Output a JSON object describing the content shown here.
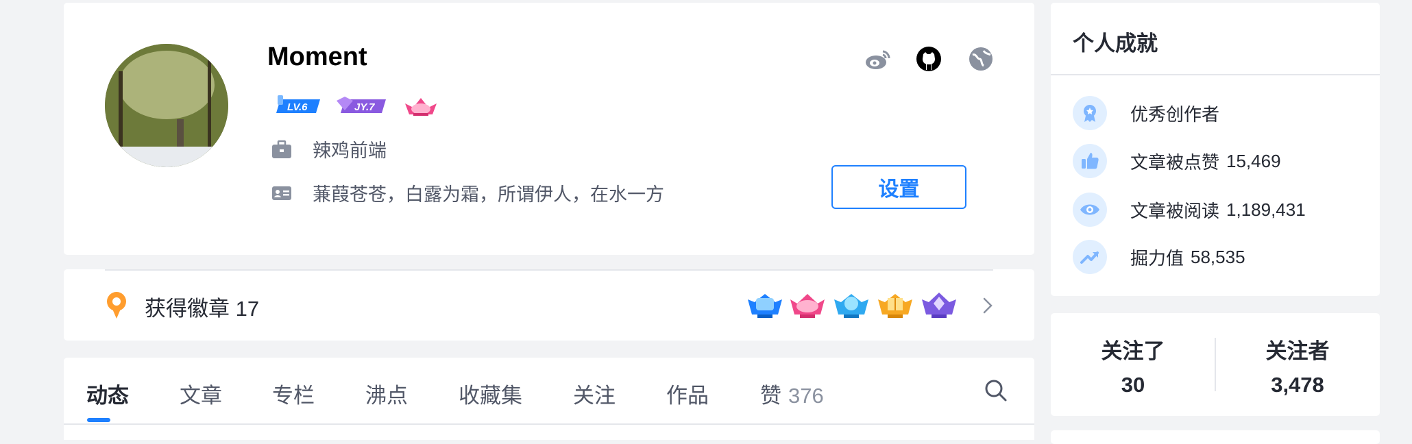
{
  "profile": {
    "username": "Moment",
    "levels": [
      {
        "name": "level-badge",
        "text": "LV.6",
        "color": "#1e80ff"
      },
      {
        "name": "jy-badge",
        "text": "JY.7",
        "color": "#8a5ae0"
      }
    ],
    "company": "辣鸡前端",
    "bio": "蒹葭苍苍，白露为霜，所谓伊人，在水一方",
    "settings_label": "设置",
    "social_icons": [
      "weibo-icon",
      "github-icon",
      "globe-icon"
    ]
  },
  "badges": {
    "label": "获得徽章 17",
    "icons": [
      "badge-blue",
      "badge-watermelon",
      "badge-cyan",
      "badge-gold",
      "badge-purple"
    ]
  },
  "tabs": {
    "items": [
      {
        "label": "动态",
        "active": true
      },
      {
        "label": "文章"
      },
      {
        "label": "专栏"
      },
      {
        "label": "沸点"
      },
      {
        "label": "收藏集"
      },
      {
        "label": "关注"
      },
      {
        "label": "作品"
      },
      {
        "label": "赞",
        "count": "376"
      }
    ]
  },
  "achievements": {
    "title": "个人成就",
    "items": [
      {
        "icon": "award-icon",
        "label": "优秀创作者",
        "value": ""
      },
      {
        "icon": "thumbs-up-icon",
        "label": "文章被点赞",
        "value": "15,469"
      },
      {
        "icon": "eye-icon",
        "label": "文章被阅读",
        "value": "1,189,431"
      },
      {
        "icon": "trend-up-icon",
        "label": "掘力值",
        "value": "58,535"
      }
    ]
  },
  "follow": {
    "following_label": "关注了",
    "following_count": "30",
    "followers_label": "关注者",
    "followers_count": "3,478"
  },
  "colors": {
    "accent": "#1e80ff",
    "bg": "#f2f3f5",
    "icon_bg": "#e1efff"
  }
}
